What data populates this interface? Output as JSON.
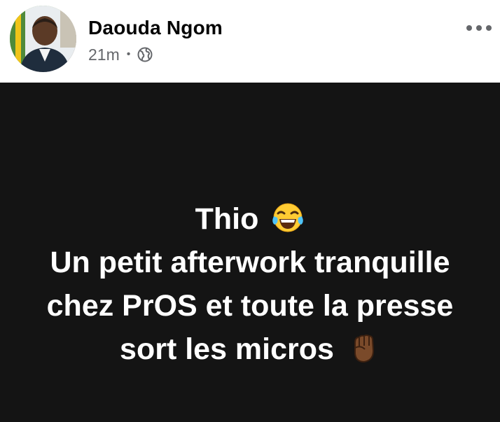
{
  "post": {
    "author": {
      "name": "Daouda Ngom"
    },
    "timestamp": "21m",
    "separator": "•",
    "audience_icon": "globe-icon",
    "more_icon": "more-options-icon",
    "colors": {
      "background": "#141414",
      "text": "#ffffff",
      "name": "#050505",
      "meta": "#65676b"
    },
    "lines": [
      {
        "text": "Thio",
        "emoji": "face-with-tears-of-joy-icon"
      },
      {
        "text": "Un petit afterwork tranquille"
      },
      {
        "text": "chez PrOS et toute la presse"
      },
      {
        "text": "sort les micros",
        "emoji": "raised-fist-icon"
      }
    ]
  }
}
